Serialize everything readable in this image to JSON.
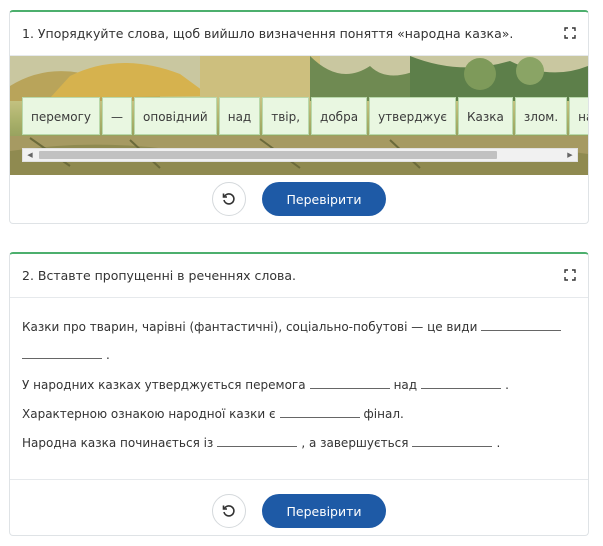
{
  "task1": {
    "title": "1. Упорядкуйте слова, щоб вийшло визначення поняття «народна казка».",
    "words": [
      "перемогу",
      "—",
      "оповідний",
      "над",
      "твір,",
      "добра",
      "утверджує",
      "Казка",
      "злом.",
      "наро"
    ],
    "reset_icon": "reset-icon",
    "check_label": "Перевірити"
  },
  "task2": {
    "title": "2. Вставте пропущенні в реченнях слова.",
    "sentences": {
      "s1_a": "Казки про тварин, чарівні (фантастичні), соціально-побутові — це види",
      "s1_end": ".",
      "s2_a": "У народних казках утверджується перемога",
      "s2_b": "над",
      "s2_end": ".",
      "s3_a": "Характерною ознакою народної казки є",
      "s3_b": "фінал.",
      "s4_a": "Народна казка починається із",
      "s4_b": ", а завершується",
      "s4_end": "."
    },
    "check_label": "Перевірити"
  },
  "colors": {
    "accent": "#1e5aa6",
    "top_border": "#4caf6d",
    "word_bg": "#e9f7e1"
  }
}
